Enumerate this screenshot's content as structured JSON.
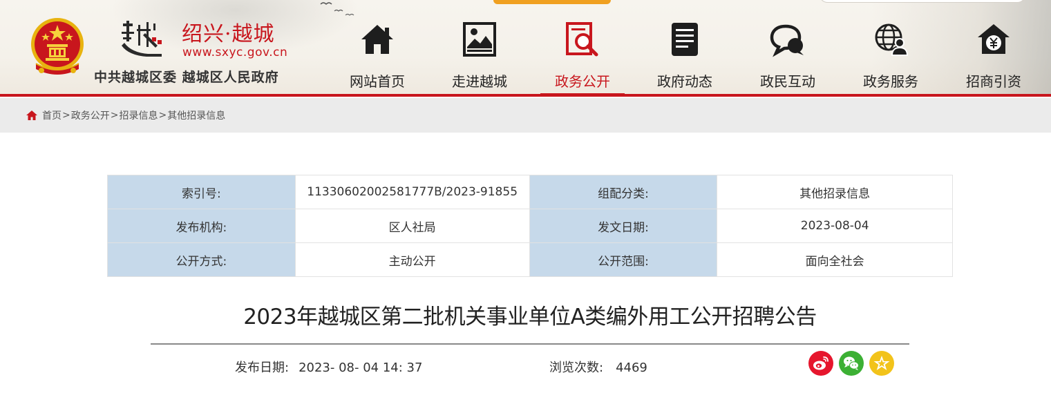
{
  "header": {
    "site_name": "绍兴·越城",
    "site_url": "www.sxyc.gov.cn",
    "gov_name": "中共越城区委 越城区人民政府",
    "accent_color": "#c8161d",
    "emblem_icon": "national-emblem-icon",
    "logo_icon": "yue-calligraphy-logo"
  },
  "nav": {
    "items": [
      {
        "label": "网站首页",
        "icon": "house-icon"
      },
      {
        "label": "走进越城",
        "icon": "picture-frame-icon"
      },
      {
        "label": "政务公开",
        "icon": "magnifier-document-icon",
        "active": true
      },
      {
        "label": "政府动态",
        "icon": "document-list-icon"
      },
      {
        "label": "政民互动",
        "icon": "chat-bubbles-icon"
      },
      {
        "label": "政务服务",
        "icon": "globe-person-icon"
      },
      {
        "label": "招商引资",
        "icon": "house-yen-icon"
      }
    ]
  },
  "breadcrumb": {
    "items": [
      "首页",
      "政务公开",
      "招录信息",
      "其他招录信息"
    ],
    "separator": ">",
    "icon": "home-icon"
  },
  "meta": {
    "rows": [
      {
        "l1": "索引号:",
        "v1": "11330602002581777B/2023-91855",
        "l2": "组配分类:",
        "v2": "其他招录信息"
      },
      {
        "l1": "发布机构:",
        "v1": "区人社局",
        "l2": "发文日期:",
        "v2": "2023-08-04"
      },
      {
        "l1": "公开方式:",
        "v1": "主动公开",
        "l2": "公开范围:",
        "v2": "面向全社会"
      }
    ],
    "label_bg": "#c6d9ea"
  },
  "article": {
    "title": "2023年越城区第二批机关事业单位A类编外用工公开招聘公告",
    "publish_label": "发布日期:",
    "publish_value": "2023- 08- 04 14: 37",
    "views_label": "浏览次数:",
    "views_value": "4469"
  },
  "share": {
    "items": [
      {
        "name": "weibo-icon",
        "color": "#e6162d"
      },
      {
        "name": "wechat-icon",
        "color": "#3cb034"
      },
      {
        "name": "favorite-star-icon",
        "color": "#f2c31a"
      }
    ]
  }
}
